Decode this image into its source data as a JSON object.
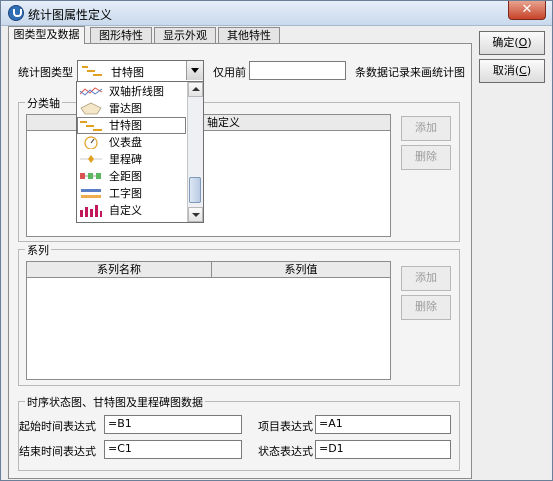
{
  "window": {
    "title": "统计图属性定义",
    "close_label": "✕"
  },
  "tabs": [
    {
      "label": "图类型及数据"
    },
    {
      "label": "图形特性"
    },
    {
      "label": "显示外观"
    },
    {
      "label": "其他特性"
    }
  ],
  "chart_type": {
    "label": "统计图类型",
    "selected": "甘特图",
    "options": [
      "双轴折线图",
      "雷达图",
      "甘特图",
      "仪表盘",
      "里程碑",
      "全距图",
      "工字图",
      "自定义"
    ]
  },
  "only_first": {
    "prefix": "仅用前",
    "value": "",
    "suffix": "条数据记录来画统计图"
  },
  "category_axis": {
    "group_title": "分类轴",
    "column_header_partial": "轴定义",
    "add_label": "添加",
    "delete_label": "删除"
  },
  "series": {
    "group_title": "系列",
    "columns": [
      "系列名称",
      "系列值"
    ],
    "add_label": "添加",
    "delete_label": "删除"
  },
  "gantt": {
    "group_title": "时序状态图、甘特图及里程碑图数据",
    "start_label": "起始时间表达式",
    "start_value": "=B1",
    "end_label": "结束时间表达式",
    "end_value": "=C1",
    "item_label": "项目表达式",
    "item_value": "=A1",
    "status_label": "状态表达式",
    "status_value": "=D1"
  },
  "buttons": {
    "ok": "确定(",
    "ok_key": "O",
    "cancel": "取消(",
    "cancel_key": "C",
    "close_paren": ")"
  },
  "colors": {
    "titlebar_top": "#e6eef8",
    "close": "#c7432a",
    "panel": "#f4f4f4"
  }
}
